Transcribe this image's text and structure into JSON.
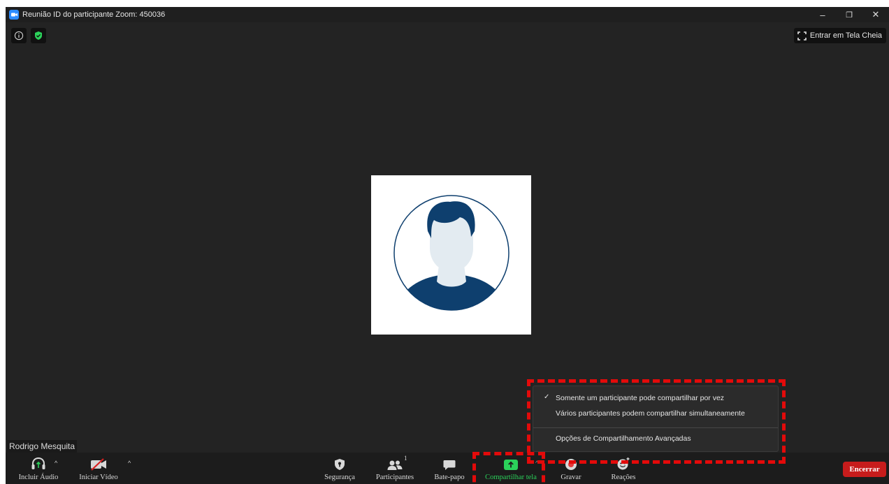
{
  "window": {
    "title": "Reunião ID do participante Zoom: 450036",
    "controls": {
      "minimize": "–",
      "restore": "❐",
      "close": "✕"
    }
  },
  "fullscreen_label": "Entrar em Tela Cheia",
  "participant_name": "Rodrigo Mesquita",
  "share_menu": {
    "items": [
      {
        "label": "Somente um participante pode compartilhar por vez",
        "checked": true
      },
      {
        "label": "Vários participantes podem compartilhar simultaneamente",
        "checked": false
      },
      {
        "label": "Opções de Compartilhamento Avançadas",
        "checked": false
      }
    ],
    "check_glyph": "✓"
  },
  "toolbar": {
    "audio": "Incluir Áudio",
    "video": "Iniciar Vídeo",
    "security": "Segurança",
    "participants": "Participantes",
    "participants_count": "1",
    "chat": "Bate-papo",
    "share": "Compartilhar tela",
    "record": "Gravar",
    "reactions": "Reações",
    "end": "Encerrar",
    "caret": "^"
  },
  "colors": {
    "accent_green": "#2bd15a",
    "end_red": "#c71c1c",
    "highlight_red": "#e30a0a",
    "avatar_navy": "#0e3f6e"
  }
}
